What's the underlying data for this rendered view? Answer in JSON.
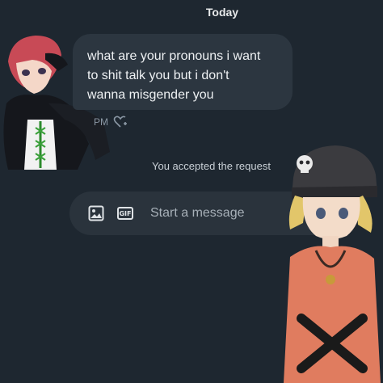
{
  "header": {
    "date_label": "Today"
  },
  "message": {
    "text_line1": "what are your pronouns i want",
    "text_line2": "to shit talk you but i don't",
    "text_line3": "wanna misgender you",
    "time_fragment": "PM"
  },
  "system": {
    "note": "You accepted the request"
  },
  "composer": {
    "placeholder": "Start a message",
    "gif_label": "GIF"
  },
  "icons": [
    "image-icon",
    "gif-icon",
    "heart-plus-icon",
    "skull-icon"
  ]
}
